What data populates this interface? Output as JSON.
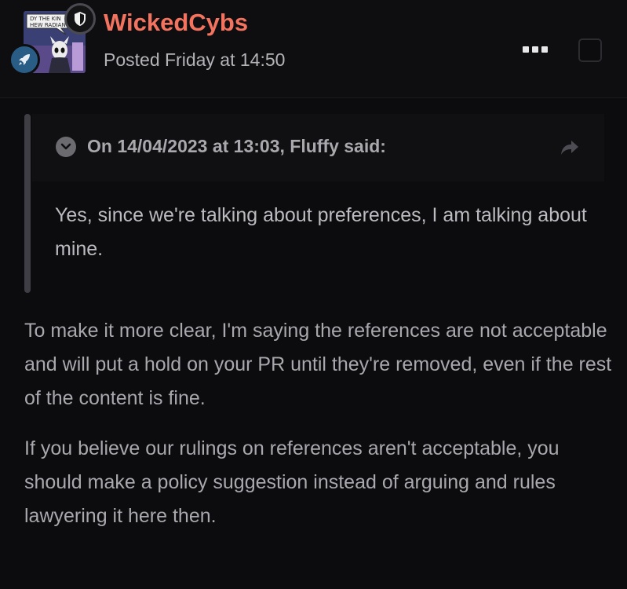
{
  "post": {
    "author": "WickedCybs",
    "posted": "Posted Friday at 14:50",
    "avatar_caption": [
      "DY THE KIN",
      "HEW RADIAN"
    ],
    "quote": {
      "citation": "On 14/04/2023 at 13:03, Fluffy said:",
      "text": "Yes, since we're talking about preferences, I am talking about mine."
    },
    "paragraphs": [
      "To make it more clear, I'm saying the references are not acceptable and will put a hold on your PR until they're removed, even if the rest of the content is fine.",
      "If you believe our rulings on references aren't acceptable, you should make a policy suggestion instead of arguing and rules lawyering it here then."
    ]
  },
  "icons": {
    "group_badge": "shield-icon",
    "rank_badge": "rocket-icon",
    "menu": "ellipsis-icon",
    "quote_toggle": "chevron-down-icon",
    "quote_share": "share-arrow-icon"
  },
  "colors": {
    "username": "#f4735f",
    "background": "#0c0c0f",
    "text": "#a8a8ad",
    "rank_badge": "#2a5d86"
  }
}
